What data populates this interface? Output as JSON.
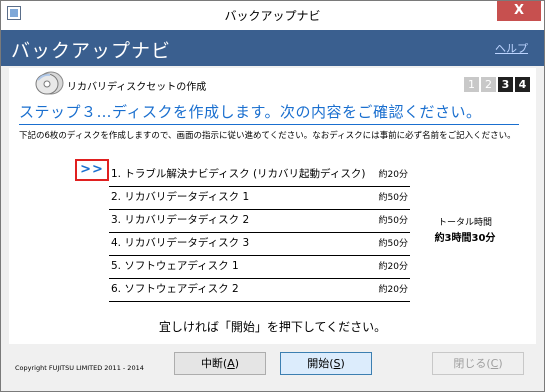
{
  "window": {
    "title": "バックアップナビ",
    "close_glyph": "X"
  },
  "header": {
    "title": "バックアップナビ",
    "help_label": "ヘルプ"
  },
  "section": {
    "title": "リカバリディスクセットの作成",
    "icon": "disc-icon"
  },
  "steps": [
    "1",
    "2",
    "3",
    "4"
  ],
  "current_step": "3",
  "step_heading": "ステップ３…ディスクを作成します。次の内容をご確認ください。",
  "instruction": "下記の6枚のディスクを作成しますので、画面の指示に従い進めてください。なおディスクには事前に必ず名前をご記入ください。",
  "current_marker": ">>",
  "discs": [
    {
      "name": "1. トラブル解決ナビディスク (リカバリ起動ディスク)",
      "time": "約20分"
    },
    {
      "name": "2. リカバリデータディスク 1",
      "time": "約50分"
    },
    {
      "name": "3. リカバリデータディスク 2",
      "time": "約50分"
    },
    {
      "name": "4. リカバリデータディスク 3",
      "time": "約50分"
    },
    {
      "name": "5. ソフトウェアディスク 1",
      "time": "約20分"
    },
    {
      "name": "6. ソフトウェアディスク 2",
      "time": "約20分"
    }
  ],
  "total": {
    "label": "トータル時間",
    "value": "約3時間30分"
  },
  "confirm_text": "宜しければ「開始」を押下してください。",
  "footer": {
    "copyright": "Copyright FUJITSU LIMITED 2011 - 2014",
    "interrupt_label": "中断(",
    "interrupt_key": "A",
    "interrupt_suffix": ")",
    "start_label": "開始(",
    "start_key": "S",
    "start_suffix": ")",
    "close_label": "閉じる(",
    "close_key": "C",
    "close_suffix": ")"
  }
}
